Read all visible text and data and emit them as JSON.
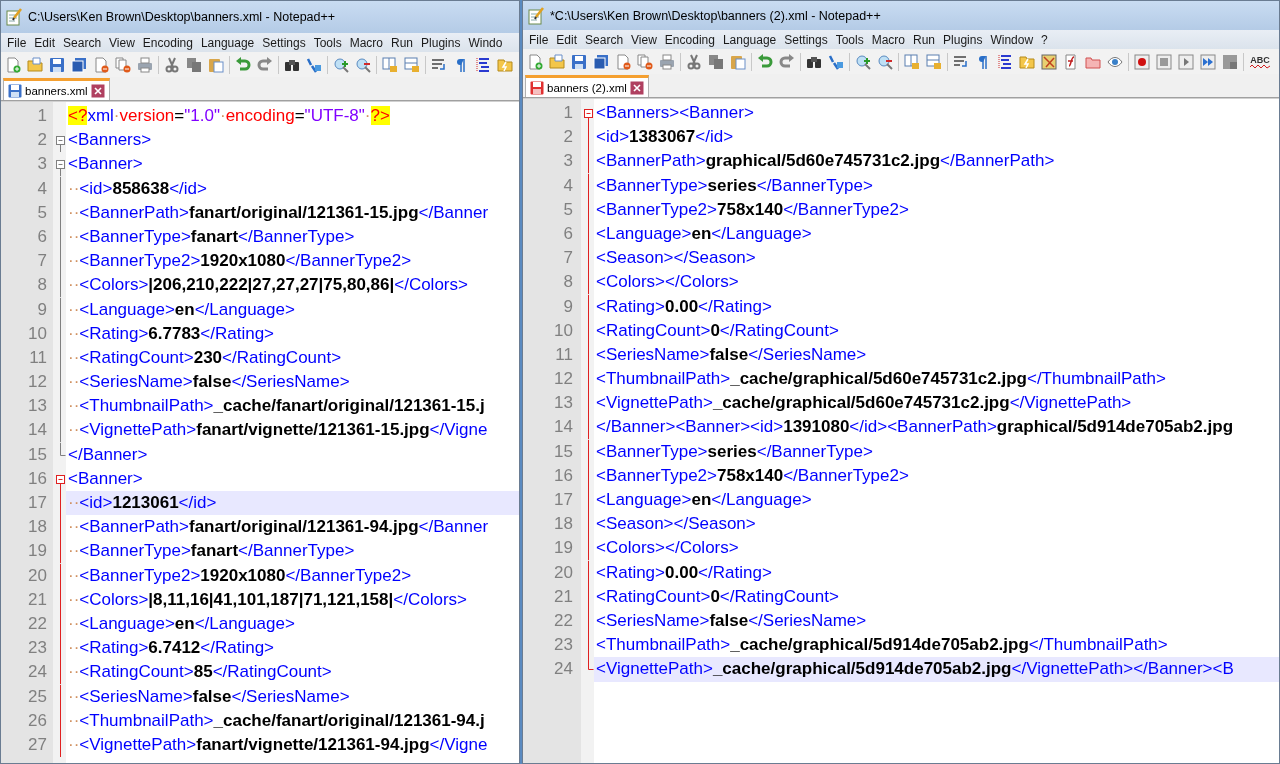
{
  "windows": [
    {
      "title": "C:\\Users\\Ken Brown\\Desktop\\banners.xml - Notepad++",
      "menus": [
        "File",
        "Edit",
        "Search",
        "View",
        "Encoding",
        "Language",
        "Settings",
        "Tools",
        "Macro",
        "Run",
        "Plugins",
        "Windo"
      ],
      "tabs": [
        {
          "label": "banners.xml",
          "selected": true,
          "modified": false
        }
      ],
      "lines": [
        {
          "number": "1",
          "kind": "plain",
          "current": false,
          "parts": [
            {
              "kind": "pi",
              "text": "<?"
            },
            {
              "kind": "plain",
              "text": "xml"
            },
            {
              "kind": "ws",
              "text": "·"
            },
            {
              "kind": "attr",
              "text": "version"
            },
            {
              "kind": "eq",
              "text": "="
            },
            {
              "kind": "str",
              "text": "\"1.0\""
            },
            {
              "kind": "ws",
              "text": "·"
            },
            {
              "kind": "attr",
              "text": "encoding"
            },
            {
              "kind": "eq",
              "text": "="
            },
            {
              "kind": "str",
              "text": "\"UTF-8\""
            },
            {
              "kind": "ws",
              "text": "·"
            },
            {
              "kind": "pi",
              "text": "?>"
            }
          ]
        },
        {
          "number": "2",
          "kind": "open",
          "color": "#808080",
          "current": false,
          "parts": [
            {
              "kind": "tag",
              "text": "<Banners>"
            }
          ]
        },
        {
          "number": "3",
          "kind": "open",
          "color": "#808080",
          "current": false,
          "parts": [
            {
              "kind": "tag",
              "text": "<Banner>"
            }
          ]
        },
        {
          "number": "4",
          "kind": "body",
          "color": "#808080",
          "current": false,
          "parts": [
            {
              "kind": "ws",
              "text": "··"
            },
            {
              "kind": "tag",
              "text": "<id>"
            },
            {
              "kind": "text",
              "text": "858638"
            },
            {
              "kind": "tag",
              "text": "</id>"
            }
          ]
        },
        {
          "number": "5",
          "kind": "body",
          "color": "#808080",
          "current": false,
          "parts": [
            {
              "kind": "ws",
              "text": "··"
            },
            {
              "kind": "tag",
              "text": "<BannerPath>"
            },
            {
              "kind": "text",
              "text": "fanart/original/121361-15.jpg"
            },
            {
              "kind": "tag",
              "text": "</Banner"
            }
          ]
        },
        {
          "number": "6",
          "kind": "body",
          "color": "#808080",
          "current": false,
          "parts": [
            {
              "kind": "ws",
              "text": "··"
            },
            {
              "kind": "tag",
              "text": "<BannerType>"
            },
            {
              "kind": "text",
              "text": "fanart"
            },
            {
              "kind": "tag",
              "text": "</BannerType>"
            }
          ]
        },
        {
          "number": "7",
          "kind": "body",
          "color": "#808080",
          "current": false,
          "parts": [
            {
              "kind": "ws",
              "text": "··"
            },
            {
              "kind": "tag",
              "text": "<BannerType2>"
            },
            {
              "kind": "text",
              "text": "1920x1080"
            },
            {
              "kind": "tag",
              "text": "</BannerType2>"
            }
          ]
        },
        {
          "number": "8",
          "kind": "body",
          "color": "#808080",
          "current": false,
          "parts": [
            {
              "kind": "ws",
              "text": "··"
            },
            {
              "kind": "tag",
              "text": "<Colors>"
            },
            {
              "kind": "text",
              "text": "|206,210,222|27,27,27|75,80,86|"
            },
            {
              "kind": "tag",
              "text": "</Colors>"
            }
          ]
        },
        {
          "number": "9",
          "kind": "body",
          "color": "#808080",
          "current": false,
          "parts": [
            {
              "kind": "ws",
              "text": "··"
            },
            {
              "kind": "tag",
              "text": "<Language>"
            },
            {
              "kind": "text",
              "text": "en"
            },
            {
              "kind": "tag",
              "text": "</Language>"
            }
          ]
        },
        {
          "number": "10",
          "kind": "body",
          "color": "#808080",
          "current": false,
          "parts": [
            {
              "kind": "ws",
              "text": "··"
            },
            {
              "kind": "tag",
              "text": "<Rating>"
            },
            {
              "kind": "text",
              "text": "6.7783"
            },
            {
              "kind": "tag",
              "text": "</Rating>"
            }
          ]
        },
        {
          "number": "11",
          "kind": "body",
          "color": "#808080",
          "current": false,
          "parts": [
            {
              "kind": "ws",
              "text": "··"
            },
            {
              "kind": "tag",
              "text": "<RatingCount>"
            },
            {
              "kind": "text",
              "text": "230"
            },
            {
              "kind": "tag",
              "text": "</RatingCount>"
            }
          ]
        },
        {
          "number": "12",
          "kind": "body",
          "color": "#808080",
          "current": false,
          "parts": [
            {
              "kind": "ws",
              "text": "··"
            },
            {
              "kind": "tag",
              "text": "<SeriesName>"
            },
            {
              "kind": "text",
              "text": "false"
            },
            {
              "kind": "tag",
              "text": "</SeriesName>"
            }
          ]
        },
        {
          "number": "13",
          "kind": "body",
          "color": "#808080",
          "current": false,
          "parts": [
            {
              "kind": "ws",
              "text": "··"
            },
            {
              "kind": "tag",
              "text": "<ThumbnailPath>"
            },
            {
              "kind": "text",
              "text": "_cache/fanart/original/121361-15.j"
            }
          ]
        },
        {
          "number": "14",
          "kind": "body",
          "color": "#808080",
          "current": false,
          "parts": [
            {
              "kind": "ws",
              "text": "··"
            },
            {
              "kind": "tag",
              "text": "<VignettePath>"
            },
            {
              "kind": "text",
              "text": "fanart/vignette/121361-15.jpg"
            },
            {
              "kind": "tag",
              "text": "</Vigne"
            }
          ]
        },
        {
          "number": "15",
          "kind": "close",
          "color": "#808080",
          "current": false,
          "parts": [
            {
              "kind": "tag",
              "text": "</Banner>"
            }
          ]
        },
        {
          "number": "16",
          "kind": "open",
          "color": "#e02020",
          "current": false,
          "parts": [
            {
              "kind": "tag",
              "text": "<Banner>"
            }
          ]
        },
        {
          "number": "17",
          "kind": "body",
          "color": "#e02020",
          "current": true,
          "parts": [
            {
              "kind": "ws",
              "text": "··"
            },
            {
              "kind": "tag",
              "text": "<id>"
            },
            {
              "kind": "text",
              "text": "1213061"
            },
            {
              "kind": "tag",
              "text": "</id>"
            }
          ]
        },
        {
          "number": "18",
          "kind": "body",
          "color": "#e02020",
          "current": false,
          "parts": [
            {
              "kind": "ws",
              "text": "··"
            },
            {
              "kind": "tag",
              "text": "<BannerPath>"
            },
            {
              "kind": "text",
              "text": "fanart/original/121361-94.jpg"
            },
            {
              "kind": "tag",
              "text": "</Banner"
            }
          ]
        },
        {
          "number": "19",
          "kind": "body",
          "color": "#e02020",
          "current": false,
          "parts": [
            {
              "kind": "ws",
              "text": "··"
            },
            {
              "kind": "tag",
              "text": "<BannerType>"
            },
            {
              "kind": "text",
              "text": "fanart"
            },
            {
              "kind": "tag",
              "text": "</BannerType>"
            }
          ]
        },
        {
          "number": "20",
          "kind": "body",
          "color": "#e02020",
          "current": false,
          "parts": [
            {
              "kind": "ws",
              "text": "··"
            },
            {
              "kind": "tag",
              "text": "<BannerType2>"
            },
            {
              "kind": "text",
              "text": "1920x1080"
            },
            {
              "kind": "tag",
              "text": "</BannerType2>"
            }
          ]
        },
        {
          "number": "21",
          "kind": "body",
          "color": "#e02020",
          "current": false,
          "parts": [
            {
              "kind": "ws",
              "text": "··"
            },
            {
              "kind": "tag",
              "text": "<Colors>"
            },
            {
              "kind": "text",
              "text": "|8,11,16|41,101,187|71,121,158|"
            },
            {
              "kind": "tag",
              "text": "</Colors>"
            }
          ]
        },
        {
          "number": "22",
          "kind": "body",
          "color": "#e02020",
          "current": false,
          "parts": [
            {
              "kind": "ws",
              "text": "··"
            },
            {
              "kind": "tag",
              "text": "<Language>"
            },
            {
              "kind": "text",
              "text": "en"
            },
            {
              "kind": "tag",
              "text": "</Language>"
            }
          ]
        },
        {
          "number": "23",
          "kind": "body",
          "color": "#e02020",
          "current": false,
          "parts": [
            {
              "kind": "ws",
              "text": "··"
            },
            {
              "kind": "tag",
              "text": "<Rating>"
            },
            {
              "kind": "text",
              "text": "6.7412"
            },
            {
              "kind": "tag",
              "text": "</Rating>"
            }
          ]
        },
        {
          "number": "24",
          "kind": "body",
          "color": "#e02020",
          "current": false,
          "parts": [
            {
              "kind": "ws",
              "text": "··"
            },
            {
              "kind": "tag",
              "text": "<RatingCount>"
            },
            {
              "kind": "text",
              "text": "85"
            },
            {
              "kind": "tag",
              "text": "</RatingCount>"
            }
          ]
        },
        {
          "number": "25",
          "kind": "body",
          "color": "#e02020",
          "current": false,
          "parts": [
            {
              "kind": "ws",
              "text": "··"
            },
            {
              "kind": "tag",
              "text": "<SeriesName>"
            },
            {
              "kind": "text",
              "text": "false"
            },
            {
              "kind": "tag",
              "text": "</SeriesName>"
            }
          ]
        },
        {
          "number": "26",
          "kind": "body",
          "color": "#e02020",
          "current": false,
          "parts": [
            {
              "kind": "ws",
              "text": "··"
            },
            {
              "kind": "tag",
              "text": "<ThumbnailPath>"
            },
            {
              "kind": "text",
              "text": "_cache/fanart/original/121361-94.j"
            }
          ]
        },
        {
          "number": "27",
          "kind": "body",
          "color": "#e02020",
          "current": false,
          "parts": [
            {
              "kind": "ws",
              "text": "··"
            },
            {
              "kind": "tag",
              "text": "<VignettePath>"
            },
            {
              "kind": "text",
              "text": "fanart/vignette/121361-94.jpg"
            },
            {
              "kind": "tag",
              "text": "</Vigne"
            }
          ]
        }
      ]
    },
    {
      "title": "*C:\\Users\\Ken Brown\\Desktop\\banners (2).xml - Notepad++",
      "menus": [
        "File",
        "Edit",
        "Search",
        "View",
        "Encoding",
        "Language",
        "Settings",
        "Tools",
        "Macro",
        "Run",
        "Plugins",
        "Window",
        "?"
      ],
      "spellcheck_label": "ABC",
      "tabs": [
        {
          "label": "banners (2).xml",
          "selected": true,
          "modified": true
        }
      ],
      "lines": [
        {
          "number": "1",
          "kind": "open",
          "color": "#e02020",
          "current": false,
          "parts": [
            {
              "kind": "tag",
              "text": "<Banners><Banner>"
            }
          ]
        },
        {
          "number": "2",
          "kind": "body",
          "color": "#e02020",
          "current": false,
          "parts": [
            {
              "kind": "tag",
              "text": "<id>"
            },
            {
              "kind": "text",
              "text": "1383067"
            },
            {
              "kind": "tag",
              "text": "</id>"
            }
          ]
        },
        {
          "number": "3",
          "kind": "body",
          "color": "#e02020",
          "current": false,
          "parts": [
            {
              "kind": "tag",
              "text": "<BannerPath>"
            },
            {
              "kind": "text",
              "text": "graphical/5d60e745731c2.jpg"
            },
            {
              "kind": "tag",
              "text": "</BannerPath>"
            }
          ]
        },
        {
          "number": "4",
          "kind": "body",
          "color": "#e02020",
          "current": false,
          "parts": [
            {
              "kind": "tag",
              "text": "<BannerType>"
            },
            {
              "kind": "text",
              "text": "series"
            },
            {
              "kind": "tag",
              "text": "</BannerType>"
            }
          ]
        },
        {
          "number": "5",
          "kind": "body",
          "color": "#e02020",
          "current": false,
          "parts": [
            {
              "kind": "tag",
              "text": "<BannerType2>"
            },
            {
              "kind": "text",
              "text": "758x140"
            },
            {
              "kind": "tag",
              "text": "</BannerType2>"
            }
          ]
        },
        {
          "number": "6",
          "kind": "body",
          "color": "#e02020",
          "current": false,
          "parts": [
            {
              "kind": "tag",
              "text": "<Language>"
            },
            {
              "kind": "text",
              "text": "en"
            },
            {
              "kind": "tag",
              "text": "</Language>"
            }
          ]
        },
        {
          "number": "7",
          "kind": "body",
          "color": "#e02020",
          "current": false,
          "parts": [
            {
              "kind": "tag",
              "text": "<Season></Season>"
            }
          ]
        },
        {
          "number": "8",
          "kind": "body",
          "color": "#e02020",
          "current": false,
          "parts": [
            {
              "kind": "tag",
              "text": "<Colors></Colors>"
            }
          ]
        },
        {
          "number": "9",
          "kind": "body",
          "color": "#e02020",
          "current": false,
          "parts": [
            {
              "kind": "tag",
              "text": "<Rating>"
            },
            {
              "kind": "text",
              "text": "0.00"
            },
            {
              "kind": "tag",
              "text": "</Rating>"
            }
          ]
        },
        {
          "number": "10",
          "kind": "body",
          "color": "#e02020",
          "current": false,
          "parts": [
            {
              "kind": "tag",
              "text": "<RatingCount>"
            },
            {
              "kind": "text",
              "text": "0"
            },
            {
              "kind": "tag",
              "text": "</RatingCount>"
            }
          ]
        },
        {
          "number": "11",
          "kind": "body",
          "color": "#e02020",
          "current": false,
          "parts": [
            {
              "kind": "tag",
              "text": "<SeriesName>"
            },
            {
              "kind": "text",
              "text": "false"
            },
            {
              "kind": "tag",
              "text": "</SeriesName>"
            }
          ]
        },
        {
          "number": "12",
          "kind": "body",
          "color": "#e02020",
          "current": false,
          "parts": [
            {
              "kind": "tag",
              "text": "<ThumbnailPath>"
            },
            {
              "kind": "text",
              "text": "_cache/graphical/5d60e745731c2.jpg"
            },
            {
              "kind": "tag",
              "text": "</ThumbnailPath>"
            }
          ]
        },
        {
          "number": "13",
          "kind": "body",
          "color": "#e02020",
          "current": false,
          "parts": [
            {
              "kind": "tag",
              "text": "<VignettePath>"
            },
            {
              "kind": "text",
              "text": "_cache/graphical/5d60e745731c2.jpg"
            },
            {
              "kind": "tag",
              "text": "</VignettePath>"
            }
          ]
        },
        {
          "number": "14",
          "kind": "body",
          "color": "#e02020",
          "current": false,
          "parts": [
            {
              "kind": "tag",
              "text": "</Banner><Banner><id>"
            },
            {
              "kind": "text",
              "text": "1391080"
            },
            {
              "kind": "tag",
              "text": "</id><BannerPath>"
            },
            {
              "kind": "text",
              "text": "graphical/5d914de705ab2.jpg"
            }
          ]
        },
        {
          "number": "15",
          "kind": "body",
          "color": "#e02020",
          "current": false,
          "parts": [
            {
              "kind": "tag",
              "text": "<BannerType>"
            },
            {
              "kind": "text",
              "text": "series"
            },
            {
              "kind": "tag",
              "text": "</BannerType>"
            }
          ]
        },
        {
          "number": "16",
          "kind": "body",
          "color": "#e02020",
          "current": false,
          "parts": [
            {
              "kind": "tag",
              "text": "<BannerType2>"
            },
            {
              "kind": "text",
              "text": "758x140"
            },
            {
              "kind": "tag",
              "text": "</BannerType2>"
            }
          ]
        },
        {
          "number": "17",
          "kind": "body",
          "color": "#e02020",
          "current": false,
          "parts": [
            {
              "kind": "tag",
              "text": "<Language>"
            },
            {
              "kind": "text",
              "text": "en"
            },
            {
              "kind": "tag",
              "text": "</Language>"
            }
          ]
        },
        {
          "number": "18",
          "kind": "body",
          "color": "#e02020",
          "current": false,
          "parts": [
            {
              "kind": "tag",
              "text": "<Season></Season>"
            }
          ]
        },
        {
          "number": "19",
          "kind": "body",
          "color": "#e02020",
          "current": false,
          "parts": [
            {
              "kind": "tag",
              "text": "<Colors></Colors>"
            }
          ]
        },
        {
          "number": "20",
          "kind": "body",
          "color": "#e02020",
          "current": false,
          "parts": [
            {
              "kind": "tag",
              "text": "<Rating>"
            },
            {
              "kind": "text",
              "text": "0.00"
            },
            {
              "kind": "tag",
              "text": "</Rating>"
            }
          ]
        },
        {
          "number": "21",
          "kind": "body",
          "color": "#e02020",
          "current": false,
          "parts": [
            {
              "kind": "tag",
              "text": "<RatingCount>"
            },
            {
              "kind": "text",
              "text": "0"
            },
            {
              "kind": "tag",
              "text": "</RatingCount>"
            }
          ]
        },
        {
          "number": "22",
          "kind": "body",
          "color": "#e02020",
          "current": false,
          "parts": [
            {
              "kind": "tag",
              "text": "<SeriesName>"
            },
            {
              "kind": "text",
              "text": "false"
            },
            {
              "kind": "tag",
              "text": "</SeriesName>"
            }
          ]
        },
        {
          "number": "23",
          "kind": "body",
          "color": "#e02020",
          "current": false,
          "parts": [
            {
              "kind": "tag",
              "text": "<ThumbnailPath>"
            },
            {
              "kind": "text",
              "text": "_cache/graphical/5d914de705ab2.jpg"
            },
            {
              "kind": "tag",
              "text": "</ThumbnailPath>"
            }
          ]
        },
        {
          "number": "24",
          "kind": "close",
          "color": "#e02020",
          "current": true,
          "parts": [
            {
              "kind": "tag",
              "text": "<VignettePath>"
            },
            {
              "kind": "text",
              "text": "_cache/graphical/5d914de705ab2.jpg"
            },
            {
              "kind": "tag",
              "text": "</VignettePath></Banner><B"
            }
          ]
        }
      ]
    }
  ]
}
